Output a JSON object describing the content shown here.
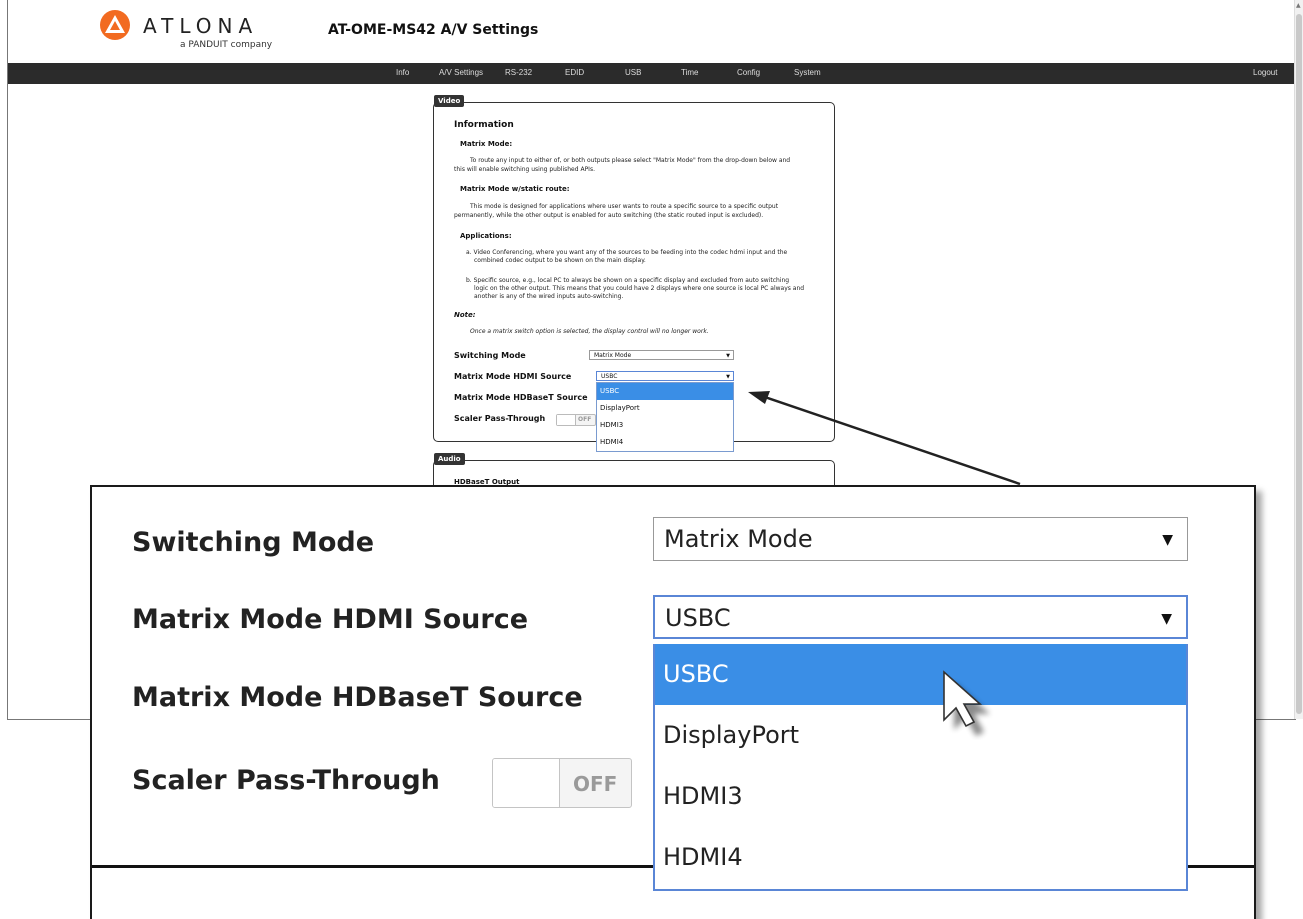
{
  "header": {
    "logo_text": "ATLONA",
    "logo_sub": "a PANDUIT company",
    "page_title": "AT-OME-MS42  A/V Settings"
  },
  "nav": {
    "items": [
      "Info",
      "A/V Settings",
      "RS-232",
      "EDID",
      "USB",
      "Time",
      "Config",
      "System"
    ],
    "logout": "Logout"
  },
  "video": {
    "legend": "Video",
    "heading": "Information",
    "matrix_mode_title": "Matrix Mode:",
    "matrix_mode_text_1": "To route any input to either of, or both outputs please select \"Matrix Mode\" from the drop-down below and",
    "matrix_mode_text_2": "this will enable switching using published APIs.",
    "static_title": "Matrix Mode w/static route:",
    "static_text_1": "This mode is designed for applications where user wants to route a specific source to a specific output",
    "static_text_2": "permanently, while the other output is enabled for auto switching (the static routed input is excluded).",
    "applications_title": "Applications:",
    "app_a_1": "a. Video Conferencing, where you want any of the sources to be feeding into the codec hdmi input and the",
    "app_a_2": "combined codec output to be shown on the main display.",
    "app_b_1": "b. Specific source, e.g., local PC to always be shown on a specific display and excluded from auto switching",
    "app_b_2": "logic on the other output. This means that you could have 2 displays where one source is local PC always and",
    "app_b_3": "another is any of the wired inputs auto-switching.",
    "note_title": "Note:",
    "note_text": "Once a matrix switch option is selected, the display control will no longer work.",
    "switching_mode_label": "Switching Mode",
    "switching_mode_value": "Matrix Mode",
    "hdmi_source_label": "Matrix Mode HDMI Source",
    "hdmi_source_value": "USBC",
    "hdbaset_source_label": "Matrix Mode HDBaseT Source",
    "scaler_label": "Scaler Pass-Through",
    "scaler_state": "OFF",
    "hdmi_source_options": [
      "USBC",
      "DisplayPort",
      "HDMI3",
      "HDMI4"
    ],
    "selected_option": "USBC"
  },
  "audio": {
    "legend": "Audio",
    "hdbaset_output": "HDBaseT Output"
  },
  "colors": {
    "nav_bg": "#2b2b2b",
    "highlight": "#3a8ee6",
    "logo_orange": "#f26b21"
  }
}
